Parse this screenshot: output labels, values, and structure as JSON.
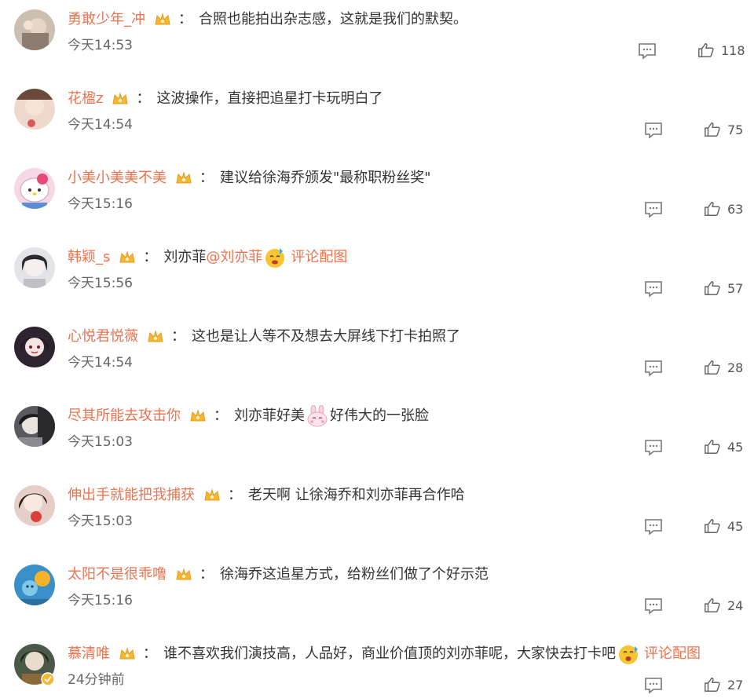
{
  "comments": [
    {
      "username": "勇敢少年_冲",
      "text": "合照也能拍出杂志感，这就是我们的默契。",
      "time": "今天14:53",
      "likes": "118",
      "avatar_color": "#c9b8a8"
    },
    {
      "username": "花楹z",
      "text": "这波操作，直接把追星打卡玩明白了",
      "time": "今天14:54",
      "likes": "75",
      "avatar_color": "#e8c7b8"
    },
    {
      "username": "小美小美美不美",
      "text": "建议给徐海乔颁发\"最称职粉丝奖\"",
      "time": "今天15:16",
      "likes": "63",
      "avatar_color": "#f2c6d8"
    },
    {
      "username": "韩颖_s",
      "text_before": "刘亦菲",
      "mention": "@刘亦菲",
      "pic_label": "评论配图",
      "time": "今天15:56",
      "likes": "57",
      "avatar_color": "#d8d8dc"
    },
    {
      "username": "心悦君悦薇",
      "text": "这也是让人等不及想去大屏线下打卡拍照了",
      "time": "今天14:54",
      "likes": "28",
      "avatar_color": "#3a2e3a"
    },
    {
      "username": "尽其所能去攻击你",
      "text_before": "刘亦菲好美",
      "text_after": "好伟大的一张脸",
      "time": "今天15:03",
      "likes": "45",
      "avatar_color": "#4a4a4a"
    },
    {
      "username": "伸出手就能把我捕获",
      "text": "老天啊 让徐海乔和刘亦菲再合作哈",
      "time": "今天15:03",
      "likes": "45",
      "avatar_color": "#d9b3a6"
    },
    {
      "username": "太阳不是很乖噜",
      "text": "徐海乔这追星方式，给粉丝们做了个好示范",
      "time": "今天15:16",
      "likes": "24",
      "avatar_color": "#2f7fb8"
    },
    {
      "username": "慕清唯",
      "text": "谁不喜欢我们演技高，人品好，商业价值顶的刘亦菲呢，大家快去打卡吧",
      "pic_label": "评论配图",
      "time": "24分钟前",
      "likes": "27",
      "avatar_color": "#3c4a3a"
    }
  ],
  "colors": {
    "username": "#eb7350",
    "text": "#333333",
    "time": "#666666",
    "crown": "#f5b731"
  },
  "icons": {
    "badge": "crown-icon",
    "reply": "comment-icon",
    "like": "thumbs-up-icon",
    "vip": "verified-badge-icon"
  }
}
